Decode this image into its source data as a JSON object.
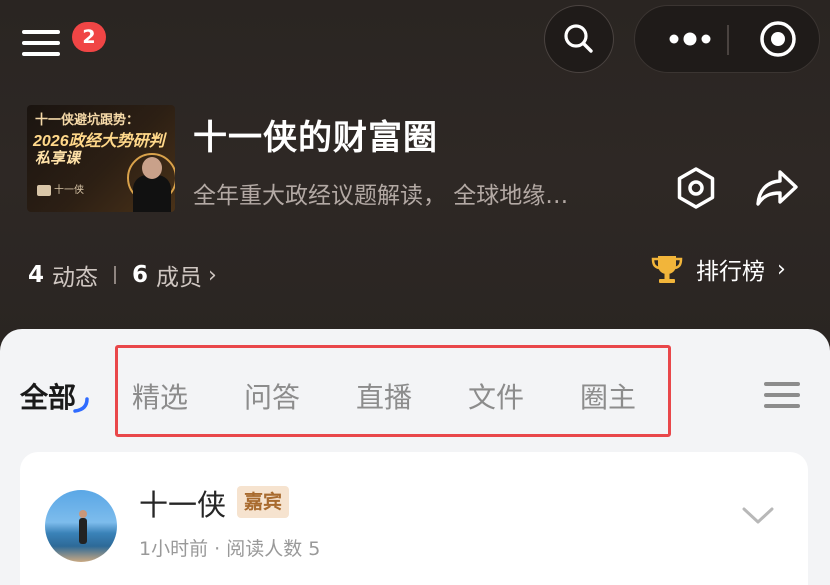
{
  "menu": {
    "badge_count": "2"
  },
  "circle": {
    "name": "十一侠的财富圈",
    "description": "全年重大政经议题解读， 全球地缘…",
    "cover": {
      "line1": "十一侠避坑跟势：",
      "line2": "2026政经大势研判",
      "line3": "私享课",
      "logo_text": "十一侠"
    }
  },
  "stats": {
    "posts_count": "4",
    "posts_label": "动态",
    "members_count": "6",
    "members_label": "成员"
  },
  "rank": {
    "label": "排行榜"
  },
  "tabs": {
    "active": "全部",
    "items": [
      "精选",
      "问答",
      "直播",
      "文件",
      "圈主"
    ]
  },
  "post": {
    "author": "十一侠",
    "badge": "嘉宾",
    "meta": "1小时前 · 阅读人数 5"
  },
  "colors": {
    "header_bg": "#2b2623",
    "badge_red": "#f04545",
    "highlight_red": "#e9474a",
    "guest_badge_bg": "#f6e3cf",
    "guest_badge_text": "#a86a2e",
    "trophy": "#f2b53a",
    "tab_underline": "#2f6bff"
  },
  "icons": [
    "menu-icon",
    "search-icon",
    "more-dots-icon",
    "close-target-icon",
    "settings-hexagon-icon",
    "share-arrow-icon",
    "trophy-icon",
    "chevron-right-icon",
    "tab-menu-icon",
    "chevron-down-icon"
  ]
}
